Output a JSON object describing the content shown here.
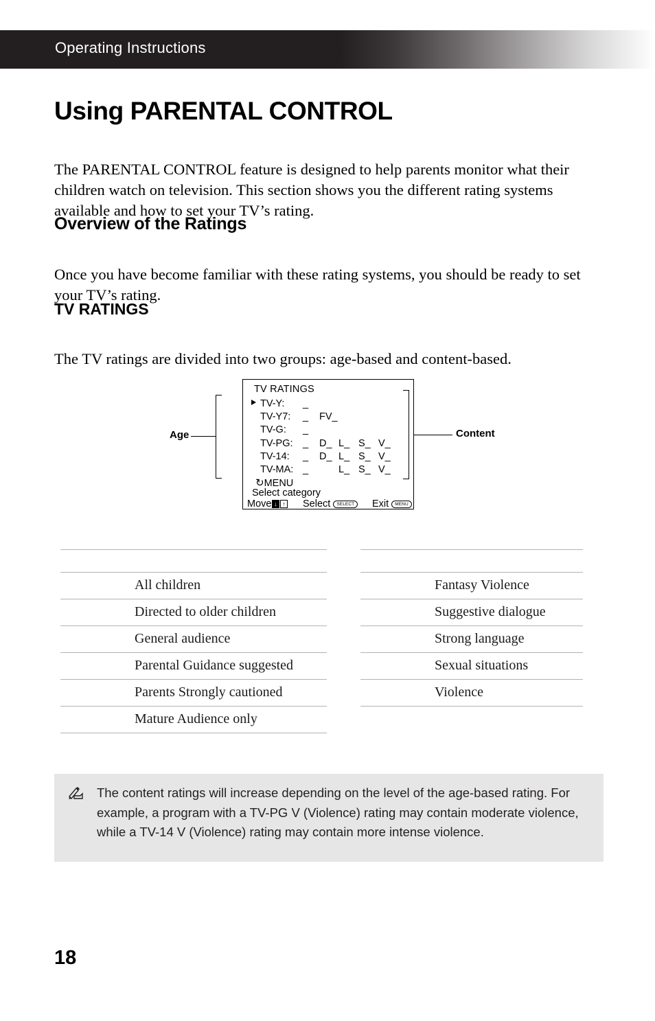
{
  "header": {
    "running_title": "Operating Instructions"
  },
  "page_title": "Using PARENTAL CONTROL",
  "intro_paragraph": "The PARENTAL CONTROL feature is designed to help parents monitor what their children watch on television. This section shows you the different rating systems available and how to set your TV’s rating.",
  "sections": {
    "overview": {
      "heading": "Overview of the Ratings",
      "paragraph": "Once you have become familiar with these rating systems, you should be ready to set your TV’s rating."
    },
    "tv_ratings": {
      "heading": "TV RATINGS",
      "paragraph": "The TV ratings are divided into two groups: age-based and content-based."
    }
  },
  "diagram": {
    "screen_title": "TV RATINGS",
    "age_label": "Age",
    "content_label": "Content",
    "rows": [
      {
        "cursor": true,
        "label": "TV-Y:",
        "value": "_",
        "content": [
          "",
          "",
          "",
          ""
        ],
        "fv": ""
      },
      {
        "cursor": false,
        "label": "TV-Y7:",
        "value": "_",
        "content": [
          "",
          "",
          "",
          ""
        ],
        "fv": "FV_"
      },
      {
        "cursor": false,
        "label": "TV-G:",
        "value": "_",
        "content": [
          "",
          "",
          "",
          ""
        ],
        "fv": ""
      },
      {
        "cursor": false,
        "label": "TV-PG:",
        "value": "_",
        "content": [
          "D_",
          "L_",
          "S_",
          "V_"
        ],
        "fv": ""
      },
      {
        "cursor": false,
        "label": "TV-14:",
        "value": "_",
        "content": [
          "D_",
          "L_",
          "S_",
          "V_"
        ],
        "fv": ""
      },
      {
        "cursor": false,
        "label": "TV-MA:",
        "value": "_",
        "content": [
          "",
          "L_",
          "S_",
          "V_"
        ],
        "fv": ""
      }
    ],
    "menu_label": "MENU",
    "select_category": "Select category",
    "footer": {
      "move_label": "Move",
      "move_keys": [
        "↓",
        "↑"
      ],
      "select_label": "Select",
      "select_button": "SELECT",
      "exit_label": "Exit",
      "exit_button": "MENU"
    }
  },
  "tables": {
    "age_based": {
      "name": "age-based-ratings",
      "header": [
        "",
        ""
      ],
      "rows": [
        {
          "code": "",
          "description": "All children"
        },
        {
          "code": "",
          "description": "Directed to older children"
        },
        {
          "code": "",
          "description": "General audience"
        },
        {
          "code": "",
          "description": "Parental Guidance suggested"
        },
        {
          "code": "",
          "description": "Parents Strongly cautioned"
        },
        {
          "code": "",
          "description": "Mature Audience only"
        }
      ]
    },
    "content_based": {
      "name": "content-based-ratings",
      "header": [
        "",
        ""
      ],
      "rows": [
        {
          "code": "",
          "description": "Fantasy Violence"
        },
        {
          "code": "",
          "description": "Suggestive dialogue"
        },
        {
          "code": "",
          "description": "Strong language"
        },
        {
          "code": "",
          "description": "Sexual situations"
        },
        {
          "code": "",
          "description": "Violence"
        }
      ]
    }
  },
  "note": {
    "icon": "note-pencil-icon",
    "text": "The content ratings will increase depending on the level of the age-based rating. For example, a program with a TV-PG V (Violence) rating may contain moderate violence, while a TV-14 V (Violence) rating may contain more intense violence."
  },
  "page_number": "18",
  "colors": {
    "header_bar": "#231f20",
    "note_background": "#e6e6e6",
    "table_rule": "#b2b2b2"
  }
}
